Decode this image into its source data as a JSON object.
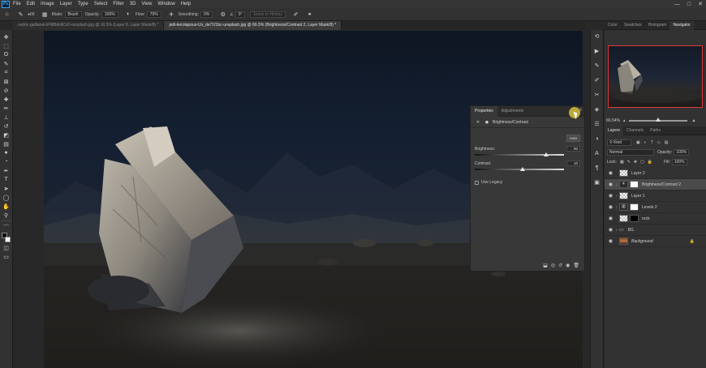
{
  "app": {
    "logo": "Ps",
    "menu": [
      "File",
      "Edit",
      "Image",
      "Layer",
      "Type",
      "Select",
      "Filter",
      "3D",
      "View",
      "Window",
      "Help"
    ],
    "window_controls": [
      "—",
      "□",
      "✕"
    ]
  },
  "options": {
    "brush_size": "66",
    "mode_label": "Mode:",
    "mode_value": "Brush",
    "opacity_label": "Opacity:",
    "opacity_value": "100%",
    "flow_label": "Flow:",
    "flow_value": "79%",
    "smoothing_label": "Smoothing:",
    "smoothing_value": "0%",
    "angle_value": "0°",
    "erase_history": "Erase to History"
  },
  "tabs": [
    {
      "label": "cedric-gallianel-tFWBdrACc0-unsplash.jpg @ 16.5% (Layer 8, Layer Mask/8) *",
      "active": false
    },
    {
      "label": "jedi-kerolapous-Us_de71f1bc-unsplash.jpg @ 66.5% (Brightness/Contrast 2, Layer Mask/8) *",
      "active": true
    }
  ],
  "properties": {
    "tab_properties": "Properties",
    "tab_adjustments": "Adjustments",
    "title": "Brightness/Contrast",
    "auto_label": "Auto",
    "brightness_label": "Brightness:",
    "brightness_value": "90",
    "contrast_label": "Contrast:",
    "contrast_value": "10",
    "legacy_label": "Use Legacy",
    "brightness_fraction": 0.8,
    "contrast_fraction": 0.54
  },
  "panels": {
    "top_tabs": [
      "Color",
      "Swatches",
      "Histogram",
      "Navigator"
    ],
    "active_top_tab": "Navigator",
    "zoom": "66.54%",
    "zoom_fraction": 0.5,
    "layer_tabs": [
      "Layers",
      "Channels",
      "Paths"
    ],
    "active_layer_tab": "Layers",
    "kind_label": "Kind",
    "blend_mode": "Normal",
    "opacity_label": "Opacity:",
    "opacity_value": "100%",
    "lock_label": "Lock:",
    "fill_label": "Fill:",
    "fill_value": "100%"
  },
  "layers": [
    {
      "name": "Layer 2",
      "thumb": "checker",
      "mask": "",
      "clip": "",
      "selected": false,
      "lock": ""
    },
    {
      "name": "Brightness/Contrast 2",
      "thumb": "adj",
      "mask": "white",
      "clip": "↓",
      "selected": true,
      "lock": ""
    },
    {
      "name": "Layer 1",
      "thumb": "checker",
      "mask": "",
      "clip": "↓",
      "selected": false,
      "lock": ""
    },
    {
      "name": "Levels 2",
      "thumb": "adj",
      "mask": "white",
      "clip": "↓",
      "selected": false,
      "lock": ""
    },
    {
      "name": "rock",
      "thumb": "checker",
      "mask": "black",
      "clip": "",
      "selected": false,
      "lock": ""
    },
    {
      "name": "BG",
      "thumb": "folder",
      "mask": "",
      "clip": "",
      "selected": false,
      "lock": ""
    },
    {
      "name": "Background",
      "thumb": "photo",
      "mask": "",
      "clip": "",
      "selected": false,
      "lock": "🔒"
    }
  ],
  "colors": {
    "accent": "#31a8ff",
    "navigator_box": "#e03a3a"
  }
}
